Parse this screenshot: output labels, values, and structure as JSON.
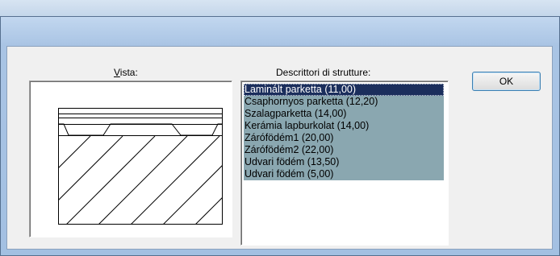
{
  "dialog": {
    "vista_label_first": "V",
    "vista_label_rest": "ista:",
    "descriptors_label": "Descrittori di strutture:",
    "ok_label": "OK"
  },
  "structures": {
    "selected_index": 0,
    "items": [
      "Laminált parketta (11,00)",
      "Csaphornyos parketta (12,20)",
      "Szalagparketta (14,00)",
      "Kerámia lapburkolat (14,00)",
      "Zárófödém1 (20,00)",
      "Zárófödém2 (22,00)",
      "Udvari födém (13,50)",
      "Udvari födém (5,00)"
    ]
  },
  "colors": {
    "list_background": "#8aa7b0",
    "selection": "#1b2e5c",
    "title_bar": "#a9c4e4"
  },
  "icons": {
    "preview": "floor-section-hatch"
  }
}
